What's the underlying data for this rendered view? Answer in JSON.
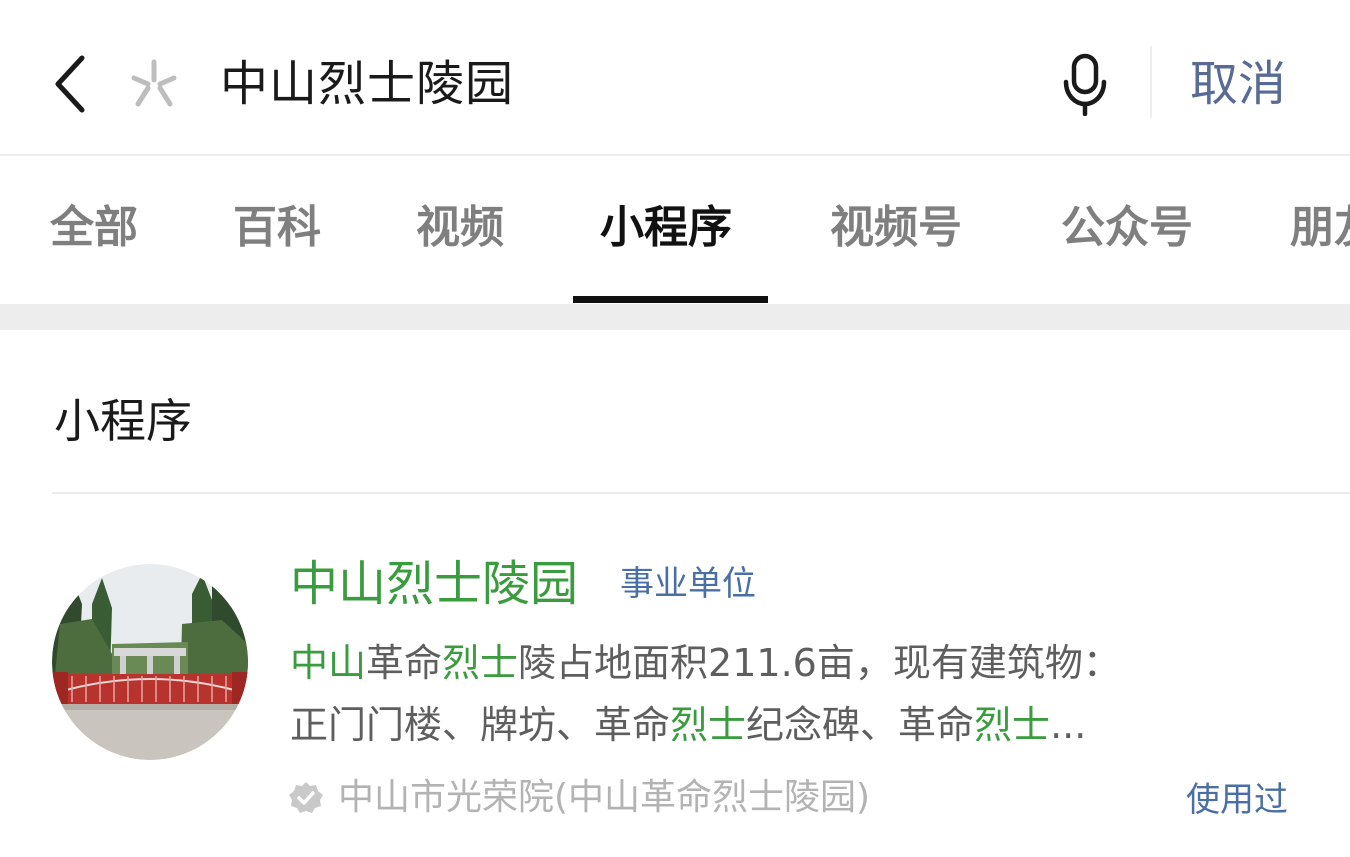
{
  "search": {
    "query": "中山烈士陵园",
    "cancel_label": "取消",
    "back_icon": "chevron-left-icon",
    "logo_icon": "search-engine-logo-icon",
    "mic_icon": "microphone-icon"
  },
  "tabs": [
    {
      "label": "全部",
      "active": false
    },
    {
      "label": "百科",
      "active": false
    },
    {
      "label": "视频",
      "active": false
    },
    {
      "label": "小程序",
      "active": true
    },
    {
      "label": "视频号",
      "active": false
    },
    {
      "label": "公众号",
      "active": false
    },
    {
      "label": "朋友",
      "active": false
    }
  ],
  "section": {
    "heading": "小程序"
  },
  "result": {
    "title": "中山烈士陵园",
    "tag": "事业单位",
    "description_line1": [
      {
        "text": "中山",
        "highlight": true
      },
      {
        "text": "革命",
        "highlight": false
      },
      {
        "text": "烈士",
        "highlight": true
      },
      {
        "text": "陵占地面积211.6亩，现有建筑物：",
        "highlight": false
      }
    ],
    "description_line2": [
      {
        "text": "正门门楼、牌坊、革命",
        "highlight": false
      },
      {
        "text": "烈士",
        "highlight": true
      },
      {
        "text": "纪念碑、革命",
        "highlight": false
      },
      {
        "text": "烈士",
        "highlight": true
      },
      {
        "text": "...",
        "highlight": false
      }
    ],
    "source": "中山市光荣院(中山革命烈士陵园)",
    "status": "使用过",
    "thumbnail_icon": "memorial-gate-photo",
    "verified_icon": "verified-badge-icon"
  },
  "colors": {
    "highlight_green": "#3b9b3f",
    "link_blue": "#576b95",
    "tag_blue": "#4a6fa5",
    "muted_gray": "#b3b3b3"
  }
}
